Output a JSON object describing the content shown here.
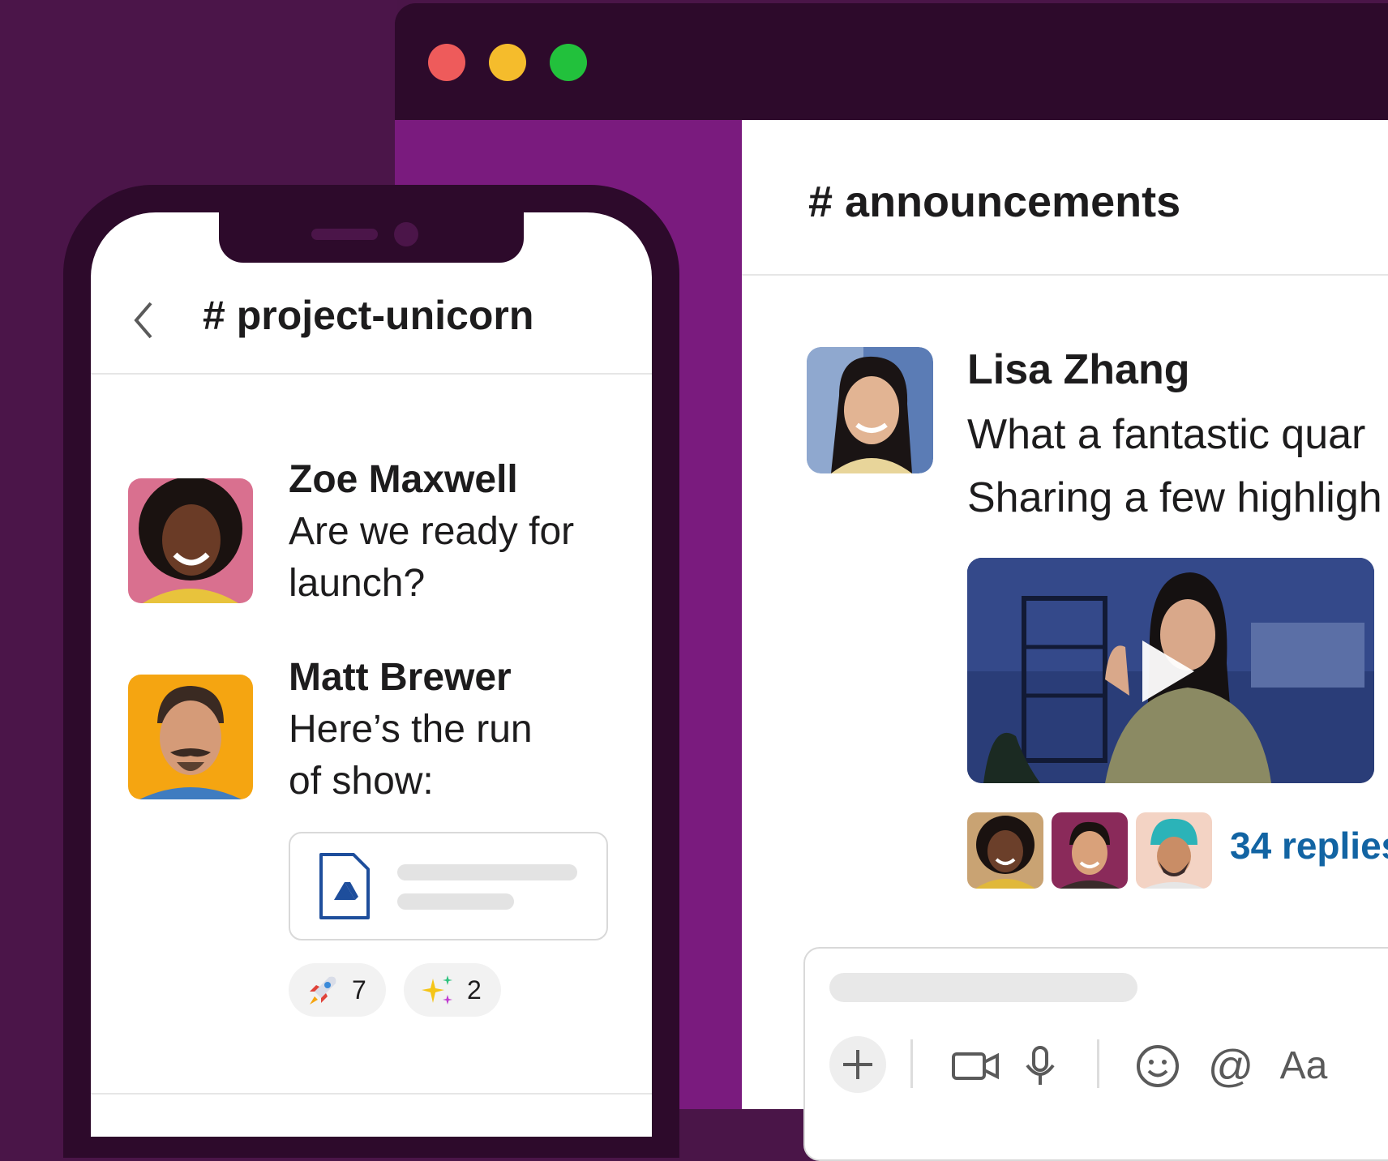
{
  "desktop": {
    "window_controls": [
      "close",
      "minimize",
      "maximize"
    ],
    "channel": "# announcements",
    "message": {
      "author": "Lisa Zhang",
      "lines": [
        "What a fantastic quar",
        "Sharing a few highligh"
      ],
      "video": {
        "icon": "play-icon"
      },
      "replies": {
        "count_label": "34 replies"
      }
    },
    "composer": {
      "tools": [
        "plus-icon",
        "video-icon",
        "microphone-icon",
        "emoji-icon",
        "mention-icon",
        "formatting-icon"
      ],
      "formatting_label": "Aa",
      "mention_label": "@"
    }
  },
  "phone": {
    "channel": "# project-unicorn",
    "messages": [
      {
        "author": "Zoe Maxwell",
        "lines": [
          "Are we ready for",
          "launch?"
        ]
      },
      {
        "author": "Matt Brewer",
        "lines": [
          "Here’s the run",
          "of show:"
        ]
      }
    ],
    "attachment": {
      "icon": "google-drive-icon"
    },
    "reactions": [
      {
        "emoji": "rocket",
        "count": "7"
      },
      {
        "emoji": "sparkles",
        "count": "2"
      }
    ]
  },
  "colors": {
    "aubergine_dark": "#2d0a2b",
    "aubergine": "#4b1549",
    "purple": "#7a1b7e",
    "link_blue": "#1264a3",
    "close_red": "#ee5b5b",
    "minimize_yellow": "#f5bc2c",
    "maximize_green": "#22c13c"
  }
}
